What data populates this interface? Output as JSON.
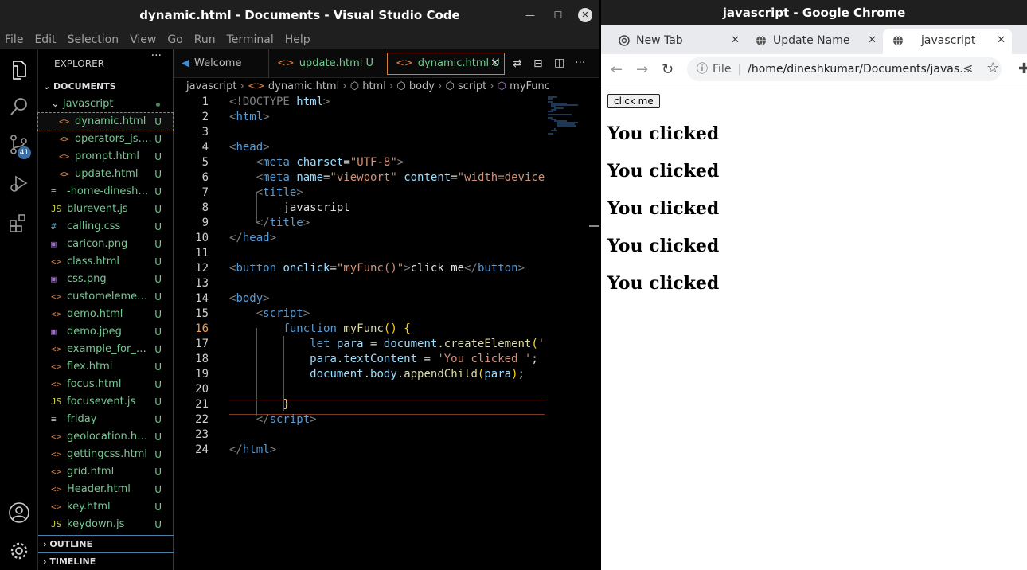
{
  "vscode": {
    "title": "dynamic.html - Documents - Visual Studio Code",
    "menu": [
      "File",
      "Edit",
      "Selection",
      "View",
      "Go",
      "Run",
      "Terminal",
      "Help"
    ],
    "scm_badge": "41",
    "explorer_title": "EXPLORER",
    "workspace": "DOCUMENTS",
    "folder": "javascript",
    "files": [
      {
        "icon": "<>",
        "name": "dynamic.html",
        "status": "U",
        "indent": true,
        "selected": true
      },
      {
        "icon": "<>",
        "name": "operators_js.h...",
        "status": "U",
        "indent": true
      },
      {
        "icon": "<>",
        "name": "prompt.html",
        "status": "U",
        "indent": true
      },
      {
        "icon": "<>",
        "name": "update.html",
        "status": "U",
        "indent": true
      },
      {
        "icon": "≡",
        "name": "-home-dineshk...",
        "status": "U"
      },
      {
        "icon": "JS",
        "name": "blurevent.js",
        "status": "U"
      },
      {
        "icon": "#",
        "name": "calling.css",
        "status": "U"
      },
      {
        "icon": "▣",
        "name": "caricon.png",
        "status": "U"
      },
      {
        "icon": "<>",
        "name": "class.html",
        "status": "U"
      },
      {
        "icon": "▣",
        "name": "css.png",
        "status": "U"
      },
      {
        "icon": "<>",
        "name": "customelement...",
        "status": "U"
      },
      {
        "icon": "<>",
        "name": "demo.html",
        "status": "U"
      },
      {
        "icon": "▣",
        "name": "demo.jpeg",
        "status": "U"
      },
      {
        "icon": "<>",
        "name": "example_for_e...",
        "status": "U"
      },
      {
        "icon": "<>",
        "name": "flex.html",
        "status": "U"
      },
      {
        "icon": "<>",
        "name": "focus.html",
        "status": "U"
      },
      {
        "icon": "JS",
        "name": "focusevent.js",
        "status": "U"
      },
      {
        "icon": "≡",
        "name": "friday",
        "status": "U"
      },
      {
        "icon": "<>",
        "name": "geolocation.html",
        "status": "U"
      },
      {
        "icon": "<>",
        "name": "gettingcss.html",
        "status": "U"
      },
      {
        "icon": "<>",
        "name": "grid.html",
        "status": "U"
      },
      {
        "icon": "<>",
        "name": "Header.html",
        "status": "U"
      },
      {
        "icon": "<>",
        "name": "key.html",
        "status": "U"
      },
      {
        "icon": "JS",
        "name": "keydown.js",
        "status": "U"
      }
    ],
    "outline": "OUTLINE",
    "timeline": "TIMELINE",
    "tabs": [
      {
        "label": "Welcome"
      },
      {
        "label": "update.html",
        "status": "U"
      },
      {
        "label": "dynamic.html",
        "status": "U"
      }
    ],
    "breadcrumb": [
      "javascript",
      "dynamic.html",
      "html",
      "body",
      "script",
      "myFunc"
    ],
    "line_numbers": [
      "1",
      "2",
      "3",
      "4",
      "5",
      "6",
      "7",
      "8",
      "9",
      "10",
      "11",
      "12",
      "13",
      "14",
      "15",
      "16",
      "17",
      "18",
      "19",
      "20",
      "21",
      "22",
      "23",
      "24"
    ]
  },
  "chrome": {
    "title": "javascript - Google Chrome",
    "tabs": [
      "New Tab",
      "Update Name",
      "javascript"
    ],
    "url_prefix": "File",
    "url": "/home/dineshkumar/Documents/javas...",
    "button_label": "click me",
    "paragraphs": [
      "You clicked",
      "You clicked",
      "You clicked",
      "You clicked",
      "You clicked"
    ]
  }
}
